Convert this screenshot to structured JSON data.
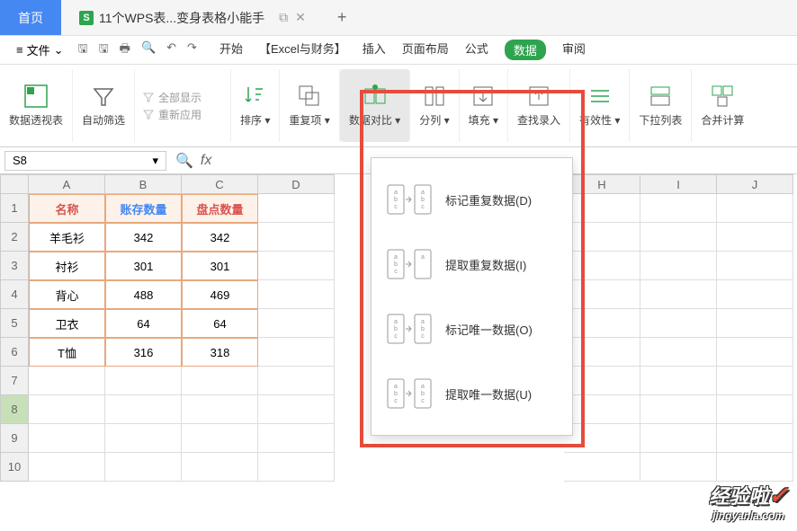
{
  "title_tabs": {
    "home": "首页",
    "doc_icon": "S",
    "doc_name": "11个WPS表...变身表格小能手"
  },
  "menu": {
    "file": "文件",
    "tabs": [
      "开始",
      "【Excel与财务】",
      "插入",
      "页面布局",
      "公式",
      "数据",
      "审阅"
    ]
  },
  "ribbon": {
    "pivot": "数据透视表",
    "autofilter": "自动筛选",
    "show_all": "全部显示",
    "reapply": "重新应用",
    "sort": "排序",
    "duplicates": "重复项",
    "compare": "数据对比",
    "split": "分列",
    "fill": "填充",
    "find_entry": "查找录入",
    "validity": "有效性",
    "dropdown_list": "下拉列表",
    "consolidate": "合并计算"
  },
  "formula_bar": {
    "name_box": "S8",
    "fx": "fx"
  },
  "columns": [
    "A",
    "B",
    "C",
    "D",
    "H",
    "I",
    "J"
  ],
  "table": {
    "headers": [
      "名称",
      "账存数量",
      "盘点数量"
    ],
    "rows": [
      [
        "羊毛衫",
        "342",
        "342"
      ],
      [
        "衬衫",
        "301",
        "301"
      ],
      [
        "背心",
        "488",
        "469"
      ],
      [
        "卫衣",
        "64",
        "64"
      ],
      [
        "T恤",
        "316",
        "318"
      ]
    ]
  },
  "row_numbers": [
    "1",
    "2",
    "3",
    "4",
    "5",
    "6",
    "7",
    "8",
    "9",
    "10"
  ],
  "dropdown": {
    "items": [
      "标记重复数据(D)",
      "提取重复数据(I)",
      "标记唯一数据(O)",
      "提取唯一数据(U)"
    ]
  },
  "watermark": {
    "main": "经验啦",
    "sub": "jingyanla.com"
  }
}
